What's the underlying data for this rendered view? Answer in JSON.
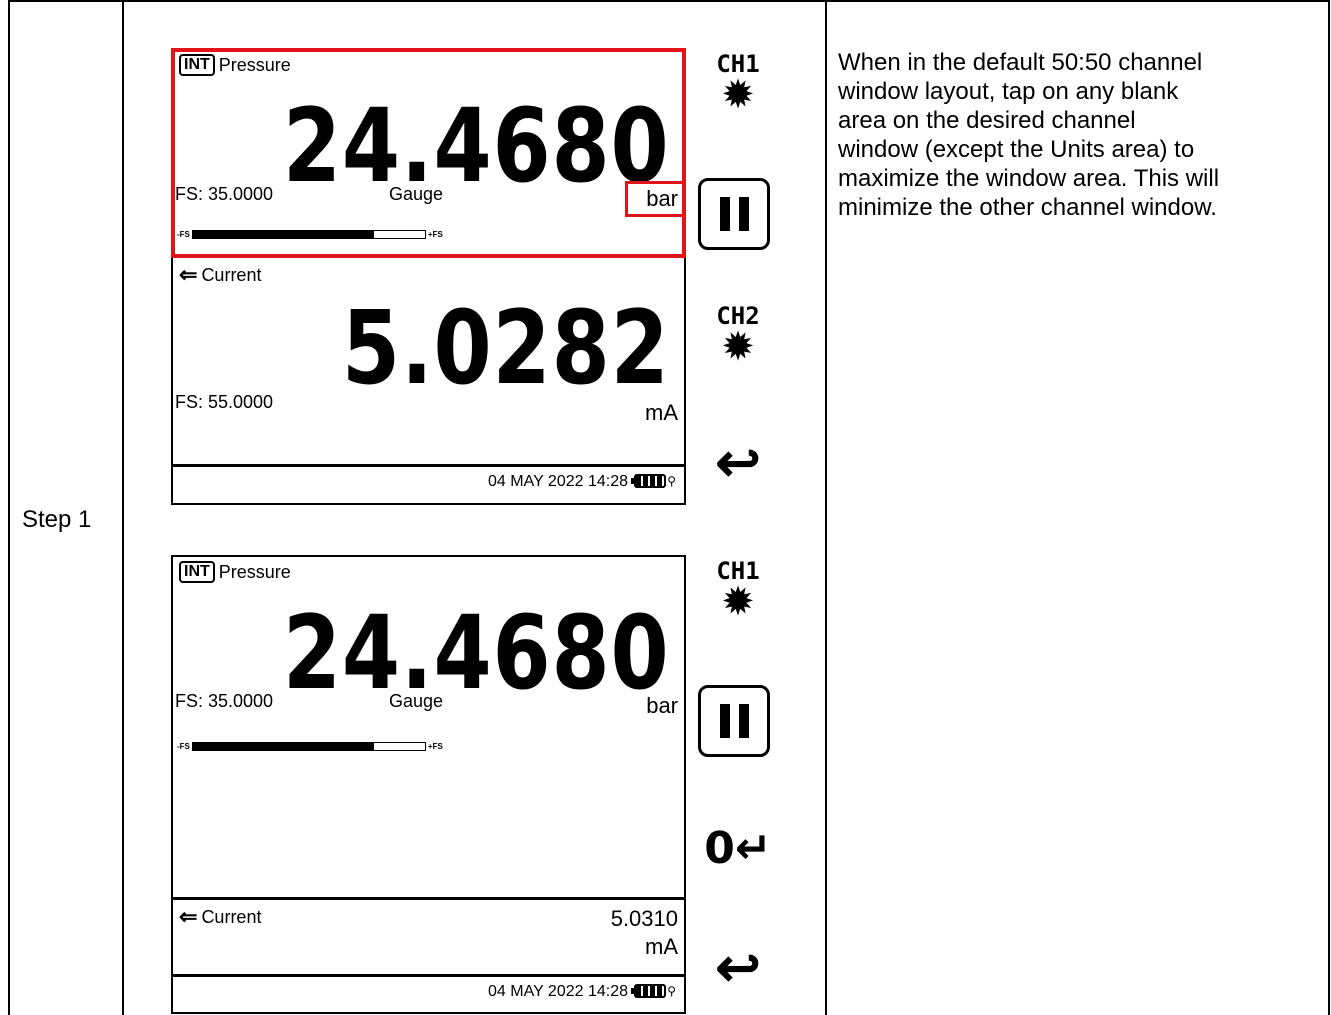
{
  "step_label": "Step 1",
  "description": "When in the default 50:50 channel\nwindow layout, tap on any blank\narea on the desired channel\nwindow (except the Units area) to\nmaximize the window area. This will\nminimize the other channel window.",
  "highlight_color": "#e0151c",
  "screen_top": {
    "ch1": {
      "badge": "INT",
      "title": "Pressure",
      "reading": "24.4680",
      "fs": "FS: 35.0000",
      "mode": "Gauge",
      "unit": "bar",
      "bar_min_label": "-FS",
      "bar_max_label": "+FS",
      "bar_level_fraction": 0.78
    },
    "ch2": {
      "icon": "input-arrow-icon",
      "title": "Current",
      "reading": "5.0282",
      "fs": "FS: 55.0000",
      "unit": "mA"
    },
    "datetime": "04 MAY 2022 14:28",
    "controls": {
      "ch1_label": "CH1",
      "ch2_label": "CH2"
    }
  },
  "screen_bottom": {
    "ch1": {
      "badge": "INT",
      "title": "Pressure",
      "reading": "24.4680",
      "fs": "FS: 35.0000",
      "mode": "Gauge",
      "unit": "bar",
      "bar_min_label": "-FS",
      "bar_max_label": "+FS",
      "bar_level_fraction": 0.78
    },
    "ch2": {
      "icon": "input-arrow-icon",
      "title": "Current",
      "reading": "5.0310",
      "unit": "mA"
    },
    "datetime": "04 MAY 2022 14:28",
    "controls": {
      "ch1_label": "CH1",
      "zero_label": "0"
    }
  }
}
